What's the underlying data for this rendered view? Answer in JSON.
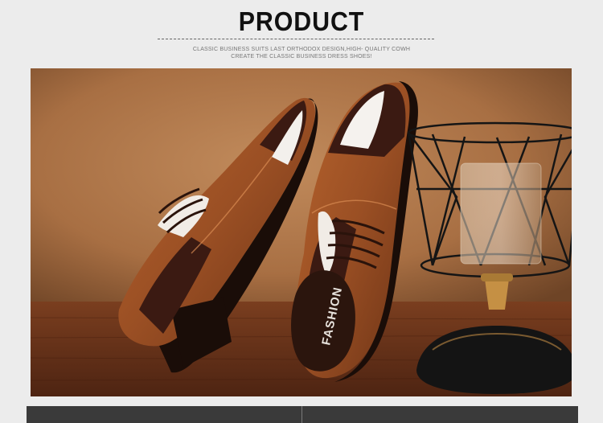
{
  "header": {
    "title": "PRODUCT",
    "subtitle_line1": "CLASSIC BUSINESS SUITS LAST ORTHODOX DESIGN,HIGH- QUALITY COWH",
    "subtitle_line2": "CREATE THE CLASSIC BUSINESS DRESS SHOES!"
  },
  "photo": {
    "insole_text": "FASHION"
  },
  "colors": {
    "background": "#ececec",
    "wall": "#b27a4e",
    "leather": "#9a4f24",
    "dark_brown": "#3b1a12",
    "bar": "#3a3a3a"
  }
}
